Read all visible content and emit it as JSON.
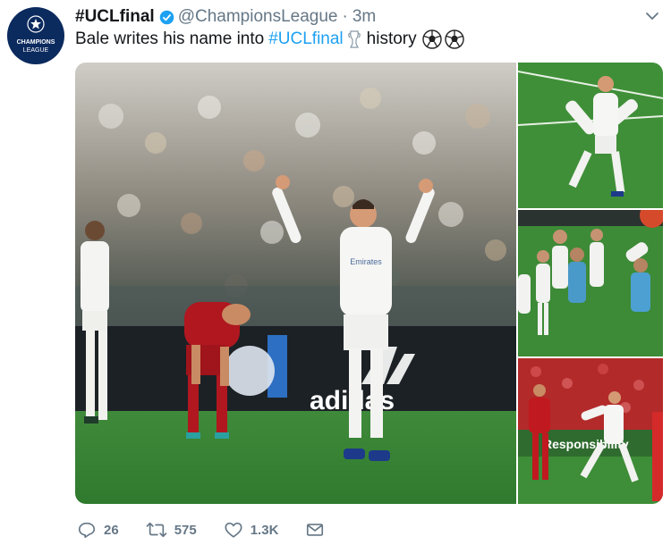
{
  "account": {
    "name": "#UCLfinal",
    "handle": "@ChampionsLeague",
    "separator": "·",
    "time": "3m",
    "avatar_text_line1": "CHAMPIONS",
    "avatar_text_line2": "LEAGUE",
    "verified_color": "#1da1f2"
  },
  "tweet": {
    "text_before": "Bale writes his name into",
    "hashtag": "#UCLfinal",
    "text_after": "history",
    "hashtag_color": "#1da1f2"
  },
  "photo_text": {
    "adidas": "adidas",
    "jersey": "Emirates",
    "board": "Responsibility"
  },
  "actions": {
    "replies": "26",
    "retweets": "575",
    "likes": "1.3K"
  }
}
